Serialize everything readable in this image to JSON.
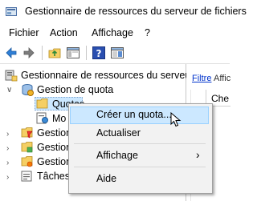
{
  "window": {
    "title": "Gestionnaire de ressources du serveur de fichiers"
  },
  "menubar": {
    "items": [
      "Fichier",
      "Action",
      "Affichage",
      "?"
    ]
  },
  "toolbar": {
    "buttons": [
      "back-arrow-icon",
      "forward-arrow-icon",
      "up-folder-icon",
      "show-hide-tree-icon",
      "help-icon",
      "properties-pane-icon"
    ]
  },
  "tree": {
    "root": "Gestionnaire de ressources du serveur",
    "quota_mgmt": "Gestion de quota",
    "quotas": "Quotas",
    "models_partial": "Mo",
    "item3": "Gestion",
    "item4": "Gestion",
    "item5": "Gestion",
    "item6": "Tâches"
  },
  "rightpane": {
    "filter_link": "Filtre",
    "filter_rest": "Affic",
    "column_header": "Che"
  },
  "context_menu": {
    "items": {
      "create_quota": "Créer un quota...",
      "refresh": "Actualiser",
      "view": "Affichage",
      "view_arrow": "›",
      "help": "Aide"
    },
    "highlighted": "Créer un quota..."
  },
  "colors": {
    "highlight_bg": "#cce8ff",
    "highlight_border": "#99d1ff",
    "link": "#0033cc",
    "menu_bg": "#f2f2f2"
  }
}
